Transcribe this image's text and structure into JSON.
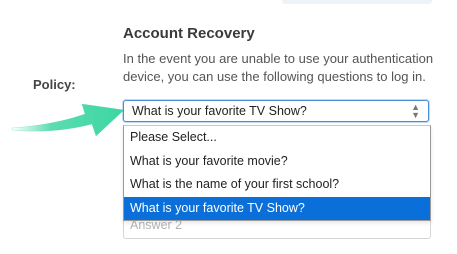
{
  "section": {
    "title": "Account Recovery",
    "description": "In the event you are unable to use your authentication device, you can use the following questions to log in."
  },
  "policy": {
    "label": "Policy:"
  },
  "security_question": {
    "selected_value": "What is your favorite TV Show?",
    "options": [
      "Please Select...",
      "What is your favorite movie?",
      "What is the name of your first school?",
      "What is your favorite TV Show?"
    ],
    "highlighted_index": 3
  },
  "answer": {
    "placeholder": "Answer 2"
  },
  "colors": {
    "arrow": "#3dd6a3",
    "focus_border": "#4a90d9",
    "highlight": "#0a6fd8"
  },
  "icons": {
    "select_caret": "up-down-chevron-icon"
  }
}
